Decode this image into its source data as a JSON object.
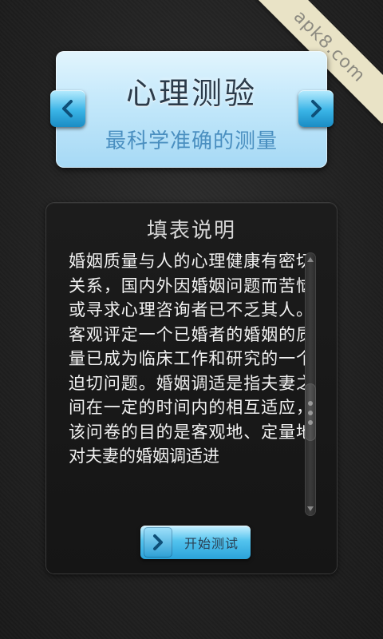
{
  "watermark": {
    "text": "apk8.com"
  },
  "header": {
    "title": "心理测验",
    "subtitle": "最科学准确的测量",
    "prev_icon": "chevron-left-icon",
    "next_icon": "chevron-right-icon"
  },
  "instructions": {
    "title": "填表说明",
    "body": "婚姻质量与人的心理健康有密切关系，国内外因婚姻问题而苦恼或寻求心理咨询者已不乏其人。客观评定一个已婚者的婚姻的质量已成为临床工作和研究的一个迫切问题。婚姻调适是指夫妻之间在一定的时间内的相互适应，该问卷的目的是客观地、定量地对夫妻的婚姻调适进"
  },
  "actions": {
    "start_label": "开始测试",
    "start_icon": "chevron-right-icon"
  },
  "colors": {
    "accent": "#3ab4e6",
    "banner": "#c6e9fb",
    "background": "#262626"
  }
}
